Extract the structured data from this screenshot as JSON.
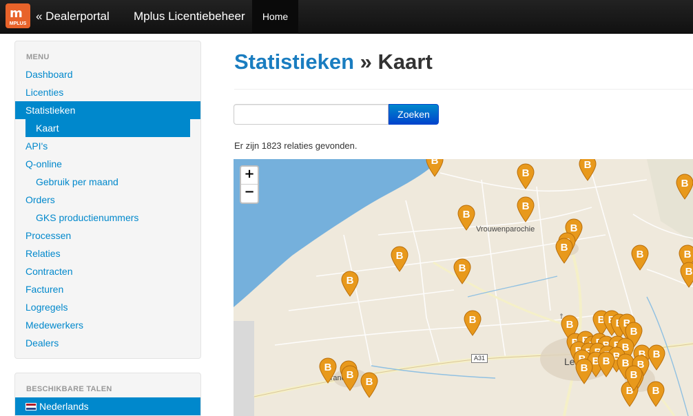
{
  "navbar": {
    "logo_text": "MPLUS",
    "brand": "« Dealerportal",
    "app_name": "Mplus Licentiebeheer",
    "home": "Home"
  },
  "sidebar": {
    "menu_header": "MENU",
    "items": [
      {
        "label": "Dashboard"
      },
      {
        "label": "Licenties"
      },
      {
        "label": "Statistieken"
      },
      {
        "label": "Kaart"
      },
      {
        "label": "API's"
      },
      {
        "label": "Q-online"
      },
      {
        "label": "Gebruik per maand"
      },
      {
        "label": "Orders"
      },
      {
        "label": "GKS productienummers"
      },
      {
        "label": "Processen"
      },
      {
        "label": "Relaties"
      },
      {
        "label": "Contracten"
      },
      {
        "label": "Facturen"
      },
      {
        "label": "Logregels"
      },
      {
        "label": "Medewerkers"
      },
      {
        "label": "Dealers"
      }
    ],
    "languages_header": "BESCHIKBARE TALEN",
    "language_selected": "Nederlands"
  },
  "main": {
    "breadcrumb_link": "Statistieken",
    "separator": "»",
    "title": "Kaart",
    "search_button": "Zoeken",
    "search_value": "",
    "result_text": "Er zijn 1823 relaties gevonden.",
    "marker_letter": "B",
    "map": {
      "zoom_in": "+",
      "zoom_out": "−",
      "labels": {
        "vrouwenparochie": "Vrouwenparochie",
        "franeker": "Franeker",
        "leeuwarden": "Le",
        "road": "A31"
      }
    }
  },
  "colors": {
    "accent": "#0088cc",
    "marker": "#e8991c",
    "water": "#75b0dc",
    "land": "#efe9dc"
  }
}
